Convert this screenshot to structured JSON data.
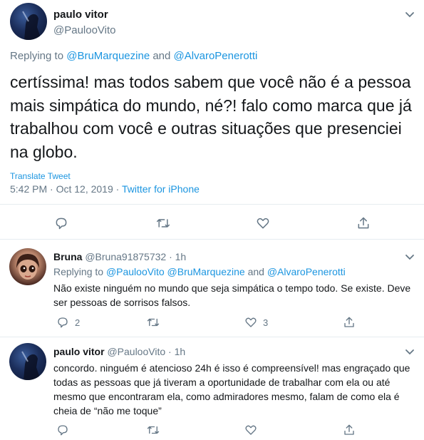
{
  "main_tweet": {
    "name": "paulo vitor",
    "handle": "@PaulooVito",
    "replying_label": "Replying to",
    "replying_user1": "@BruMarquezine",
    "replying_and": "and",
    "replying_user2": "@AlvaroPenerotti",
    "text": "certíssima! mas todos sabem que você não é a pessoa mais simpática do mundo, né?! falo como marca que já trabalhou com você e outras situações que presenciei na globo.",
    "translate": "Translate Tweet",
    "timestamp": "5:42 PM · Oct 12, 2019",
    "separator": "·",
    "source": "Twitter for iPhone"
  },
  "reply1": {
    "name": "Bruna",
    "handle": "@Bruna91875732",
    "time": "· 1h",
    "replying_label": "Replying to",
    "replying_user1": "@PaulooVito",
    "replying_user2": "@BruMarquezine",
    "replying_and": "and",
    "replying_user3": "@AlvaroPenerotti",
    "text": "Não existe ninguém no mundo que seja simpática o tempo todo. Se existe. Deve ser pessoas de sorrisos falsos.",
    "reply_count": "2",
    "like_count": "3"
  },
  "reply2": {
    "name": "paulo vitor",
    "handle": "@PaulooVito",
    "time": "· 1h",
    "text": "concordo. ninguém é atencioso 24h é isso é compreensível! mas engraçado que todas as pessoas que já tiveram a oportunidade de trabalhar com ela ou até mesmo que encontraram ela, como admiradores mesmo, falam de como ela é cheia de “não me toque”"
  },
  "colors": {
    "link": "#1b95e0",
    "secondary": "#657786",
    "text": "#14171a",
    "divider": "#e6ecf0"
  },
  "icons": {
    "reply": "reply-icon",
    "retweet": "retweet-icon",
    "like": "heart-icon",
    "share": "share-icon",
    "caret": "chevron-down-icon"
  }
}
